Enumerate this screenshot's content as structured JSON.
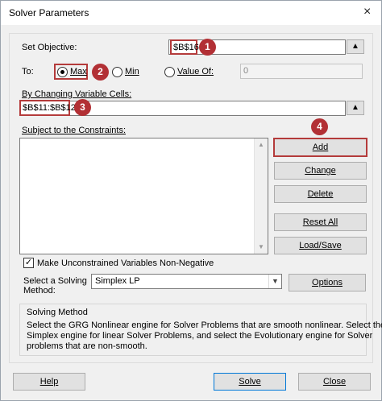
{
  "window": {
    "title": "Solver Parameters",
    "close_icon": "×"
  },
  "objective": {
    "label": "Set Objective:",
    "value": "$B$16",
    "marker": "1"
  },
  "to": {
    "label": "To:",
    "max_label": "Max",
    "min_label": "Min",
    "value_of_label": "Value Of:",
    "value_of_value": "0",
    "selected": "Max",
    "marker": "2"
  },
  "variables": {
    "label": "By Changing Variable Cells:",
    "value": "$B$11:$B$12",
    "marker": "3"
  },
  "constraints": {
    "label": "Subject to the Constraints:",
    "marker": "4",
    "buttons": {
      "add": "Add",
      "change": "Change",
      "delete": "Delete",
      "reset_all": "Reset All",
      "load_save": "Load/Save"
    }
  },
  "nonneg": {
    "label": "Make Unconstrained Variables Non-Negative",
    "checked": true
  },
  "method": {
    "label_line1": "Select a Solving",
    "label_line2": "Method:",
    "selected": "Simplex LP",
    "options_button": "Options"
  },
  "solving_method": {
    "title": "Solving Method",
    "line1": "Select the GRG Nonlinear engine for Solver Problems that are smooth nonlinear. Select the LP",
    "line2": "Simplex engine for linear Solver Problems, and select the Evolutionary engine for Solver",
    "line3": "problems that are non-smooth."
  },
  "footer": {
    "help": "Help",
    "solve": "Solve",
    "close": "Close"
  },
  "icons": {
    "collapse": "collapse-dialog-icon",
    "dropdown": "chevron-down-icon"
  },
  "colors": {
    "highlight": "#b43b3b",
    "marker": "#b23035",
    "default_button": "#0078d7"
  }
}
